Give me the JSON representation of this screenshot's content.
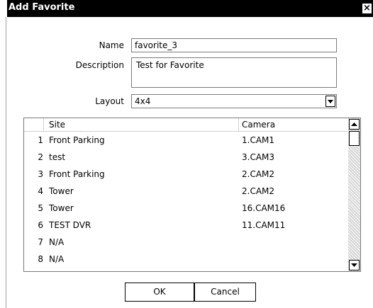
{
  "window": {
    "title": "Add Favorite",
    "close_glyph": "×"
  },
  "form": {
    "name_label": "Name",
    "name_value": "favorite_3",
    "description_label": "Description",
    "description_value": "Test for Favorite",
    "layout_label": "Layout",
    "layout_value": "4x4"
  },
  "table": {
    "columns": [
      "",
      "Site",
      "Camera"
    ],
    "rows": [
      {
        "num": "1",
        "site": "Front Parking",
        "camera": "1.CAM1"
      },
      {
        "num": "2",
        "site": "test",
        "camera": "3.CAM3"
      },
      {
        "num": "3",
        "site": "Front Parking",
        "camera": "2.CAM2"
      },
      {
        "num": "4",
        "site": "Tower",
        "camera": "2.CAM2"
      },
      {
        "num": "5",
        "site": "Tower",
        "camera": "16.CAM16"
      },
      {
        "num": "6",
        "site": "TEST DVR",
        "camera": "11.CAM11"
      },
      {
        "num": "7",
        "site": "N/A",
        "camera": ""
      },
      {
        "num": "8",
        "site": "N/A",
        "camera": ""
      }
    ]
  },
  "buttons": {
    "ok": "OK",
    "cancel": "Cancel"
  }
}
